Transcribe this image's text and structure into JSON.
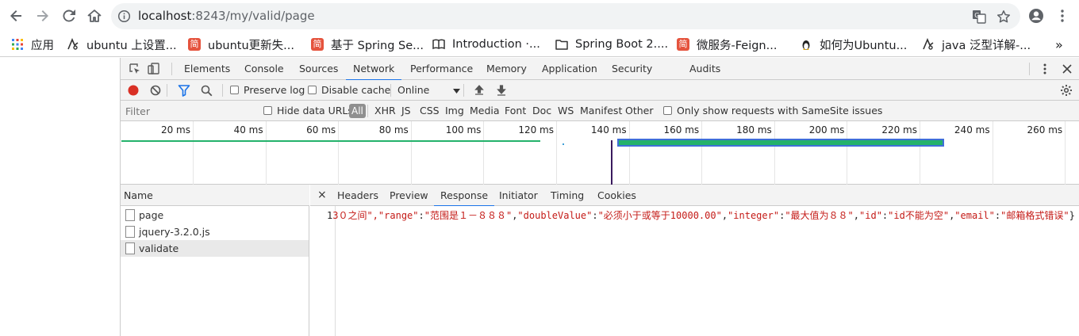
{
  "browser": {
    "url_host": "localhost",
    "url_path": ":8243/my/valid/page",
    "bookmarks": [
      {
        "label": "应用",
        "icon": "apps-grid-icon"
      },
      {
        "label": "ubuntu 上设置...",
        "icon": "ask-ubuntu-icon"
      },
      {
        "label": "ubuntu更新失...",
        "icon": "jianshu-icon"
      },
      {
        "label": "基于 Spring Se...",
        "icon": "jianshu-icon"
      },
      {
        "label": "Introduction ·...",
        "icon": "book-icon"
      },
      {
        "label": "Spring Boot 2....",
        "icon": "folder-icon"
      },
      {
        "label": "微服务-Feign...",
        "icon": "jianshu-icon"
      },
      {
        "label": "如何为Ubuntu...",
        "icon": "linux-penguin-icon"
      },
      {
        "label": "java 泛型详解-...",
        "icon": "ask-ubuntu-icon"
      }
    ],
    "more_bookmarks": "»",
    "jianshu_glyph": "简"
  },
  "devtools": {
    "tabs": [
      "Elements",
      "Console",
      "Sources",
      "Network",
      "Performance",
      "Memory",
      "Application",
      "Security",
      "Audits"
    ],
    "active_tab": "Network",
    "network_toolbar": {
      "preserve_log": "Preserve log",
      "disable_cache": "Disable cache",
      "throttling": "Online"
    },
    "filter_bar": {
      "placeholder": "Filter",
      "hide_data_urls": "Hide data URLs",
      "types": [
        "All",
        "XHR",
        "JS",
        "CSS",
        "Img",
        "Media",
        "Font",
        "Doc",
        "WS",
        "Manifest",
        "Other"
      ],
      "same_site": "Only show requests with SameSite issues"
    },
    "timeline_ticks": [
      "20 ms",
      "40 ms",
      "60 ms",
      "80 ms",
      "100 ms",
      "120 ms",
      "140 ms",
      "160 ms",
      "180 ms",
      "200 ms",
      "220 ms",
      "240 ms",
      "260 ms"
    ],
    "requests_header": "Name",
    "requests": [
      "page",
      "jquery-3.2.0.js",
      "validate"
    ],
    "detail_close": "×",
    "detail_tabs": [
      "Headers",
      "Preview",
      "Response",
      "Initiator",
      "Timing",
      "Cookies"
    ],
    "active_detail_tab": "Response",
    "response_line_number": "1",
    "response_text_start": "3０之间\",",
    "response_pairs": [
      {
        "key": "\"range\"",
        "value": "\"范围是１－８８８\""
      },
      {
        "key": "\"doubleValue\"",
        "value": "\"必须小于或等于10000.00\""
      },
      {
        "key": "\"integer\"",
        "value": "\"最大值为８８\""
      },
      {
        "key": "\"id\"",
        "value": "\"id不能为空\""
      },
      {
        "key": "\"email\"",
        "value": "\"邮箱格式错误\""
      }
    ],
    "response_end": "}"
  },
  "colors": {
    "accent": "#1a73e8",
    "record": "#d93025",
    "waterfall_green": "#24b26b",
    "waterfall_blue": "#3f6fd8"
  }
}
